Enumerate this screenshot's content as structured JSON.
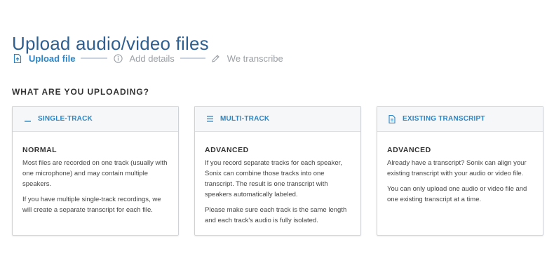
{
  "page": {
    "title": "Upload audio/video files"
  },
  "steps": [
    {
      "label": "Upload file",
      "icon": "upload-file-icon",
      "active": true
    },
    {
      "label": "Add details",
      "icon": "info-icon",
      "active": false
    },
    {
      "label": "We transcribe",
      "icon": "pencil-icon",
      "active": false
    }
  ],
  "section": {
    "heading": "WHAT ARE YOU UPLOADING?"
  },
  "cards": [
    {
      "title": "SINGLE-TRACK",
      "icon": "single-track-icon",
      "kind": "NORMAL",
      "paragraphs": [
        "Most files are recorded on one track (usually with one microphone) and may contain multiple speakers.",
        "If you have multiple single-track recordings, we will create a separate transcript for each file."
      ]
    },
    {
      "title": "MULTI-TRACK",
      "icon": "multi-track-icon",
      "kind": "ADVANCED",
      "paragraphs": [
        "If you record separate tracks for each speaker, Sonix can combine those tracks into one transcript. The result is one transcript with speakers automatically labeled.",
        "Please make sure each track is the same length and each track's audio is fully isolated."
      ]
    },
    {
      "title": "EXISTING TRANSCRIPT",
      "icon": "document-icon",
      "kind": "ADVANCED",
      "paragraphs": [
        "Already have a transcript? Sonix can align your existing transcript with your audio or video file.",
        "You can only upload one audio or video file and one existing transcript at a time."
      ]
    }
  ],
  "colors": {
    "title": "#2f5f90",
    "accent": "#2a86c8",
    "muted": "#9aa0a6"
  }
}
